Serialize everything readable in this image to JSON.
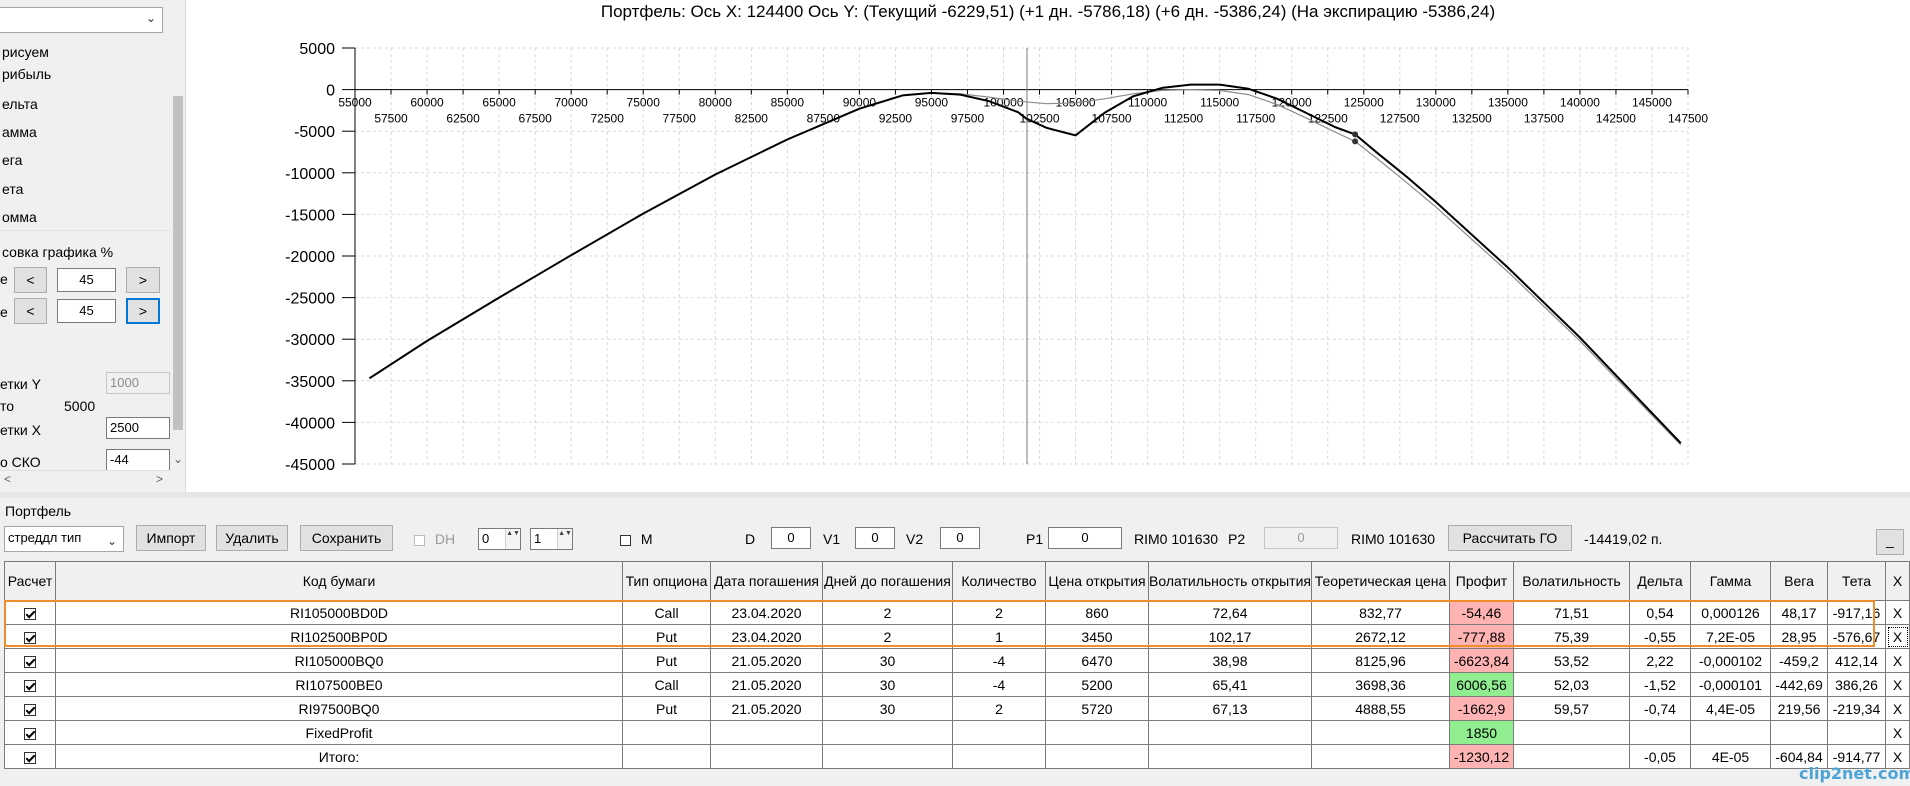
{
  "left_panel": {
    "top_select_value": "",
    "labels": [
      "рисуем",
      "рибыль",
      "ельта",
      "амма",
      "ега",
      "ета",
      "омма"
    ],
    "group_title": "совка графика %",
    "row1_prefix": "е",
    "row2_prefix": "е",
    "dec_label": "<",
    "inc_label": ">",
    "row1_value": "45",
    "row2_value": "45",
    "grid_y_label": "етки Y",
    "grid_y_value": "1000",
    "to_label": "то",
    "to_value": "5000",
    "grid_x_label": "етки X",
    "grid_x_value": "2500",
    "sko_label": "о СКО",
    "sko_value": "-44",
    "scroll_left": "<",
    "scroll_right": ">",
    "chevron": "⌄"
  },
  "chart_title": "Портфель: Ось X: 124400 Ось Y:  (Текущий -6229,51)  (+1 дн. -5786,18)  (+6 дн. -5386,24)  (На экспирацию -5386,24)",
  "chart_data": {
    "type": "line",
    "title": "Портфель: Ось X: 124400 Ось Y:  (Текущий -6229,51)  (+1 дн. -5786,18)  (+6 дн. -5386,24)  (На экспирацию -5386,24)",
    "xlim": [
      55000,
      147500
    ],
    "ylim": [
      -45000,
      5000
    ],
    "x_ticks_upper": [
      55000,
      60000,
      65000,
      70000,
      75000,
      80000,
      85000,
      90000,
      95000,
      100000,
      105000,
      110000,
      115000,
      120000,
      125000,
      130000,
      135000,
      140000,
      145000
    ],
    "x_ticks_lower": [
      57500,
      62500,
      67500,
      72500,
      77500,
      82500,
      87500,
      92500,
      97500,
      102500,
      107500,
      112500,
      117500,
      122500,
      127500,
      132500,
      137500,
      142500,
      147500
    ],
    "y_ticks": [
      5000,
      0,
      -5000,
      -10000,
      -15000,
      -20000,
      -25000,
      -30000,
      -35000,
      -40000,
      -45000
    ],
    "grid": true,
    "vertical_marker_x": 101630,
    "points_x": 124400,
    "series": [
      {
        "color": "#000000",
        "width": 2,
        "x": [
          56000,
          60000,
          65000,
          70000,
          75000,
          80000,
          85000,
          90000,
          93000,
          95000,
          97000,
          99000,
          101000,
          101600,
          103000,
          105000,
          107000,
          109000,
          111000,
          113000,
          115000,
          117000,
          119000,
          121000,
          123000,
          124400,
          126000,
          128000,
          130000,
          135000,
          140000,
          147000
        ],
        "y": [
          -34700,
          -30200,
          -25000,
          -19900,
          -14900,
          -10200,
          -6000,
          -2300,
          -700,
          -400,
          -600,
          -1400,
          -2700,
          -3500,
          -4600,
          -5500,
          -2800,
          -800,
          200,
          600,
          600,
          100,
          -1100,
          -2800,
          -4500,
          -5386,
          -7700,
          -10500,
          -13500,
          -21400,
          -29800,
          -42500
        ]
      },
      {
        "color": "#8c8c8c",
        "width": 1.2,
        "x": [
          56000,
          60000,
          65000,
          70000,
          75000,
          80000,
          85000,
          90000,
          93000,
          95000,
          97000,
          99000,
          101000,
          103000,
          105000,
          107000,
          109000,
          111000,
          113000,
          115000,
          117000,
          119000,
          121000,
          123000,
          124400,
          126000,
          128000,
          130000,
          135000,
          140000,
          147000
        ],
        "y": [
          -34700,
          -30200,
          -25000,
          -19900,
          -14900,
          -10200,
          -6000,
          -2300,
          -700,
          -400,
          -500,
          -900,
          -1400,
          -1700,
          -1600,
          -1100,
          -500,
          -100,
          0,
          -100,
          -600,
          -1800,
          -3400,
          -5100,
          -6230,
          -8400,
          -11200,
          -14100,
          -21900,
          -30200,
          -42700
        ]
      }
    ],
    "markers": [
      {
        "x": 124400,
        "y": -5386
      },
      {
        "x": 124400,
        "y": -6230
      }
    ]
  },
  "portfolio": {
    "section_title": "Портфель",
    "strategy_select": "стреддл тип",
    "import_label": "Импорт",
    "delete_label": "Удалить",
    "save_label": "Сохранить",
    "dh_label": "DH",
    "spin1_value": "0",
    "spin2_value": "1",
    "m_label": "M",
    "d_label": "D",
    "d_value": "0",
    "v1_label": "V1",
    "v1_value": "0",
    "v2_label": "V2",
    "v2_value": "0",
    "p1_label": "P1",
    "p1_value": "0",
    "rim1_label": "RIM0 101630",
    "p2_label": "P2",
    "p2_value": "0",
    "rim2_label": "RIM0 101630",
    "calc_go_label": "Рассчитать ГО",
    "go_value": "-14419,02 п.",
    "minimize_label": "_",
    "spin_arrows": "▲▼"
  },
  "table": {
    "headers": [
      "Расчет",
      "Код бумаги",
      "Тип опциона",
      "Дата погашения",
      "Дней до погашения",
      "Количество",
      "Цена открытия",
      "Волатильность открытия",
      "Теоретическая цена",
      "Профит",
      "Волатильность",
      "Дельта",
      "Гамма",
      "Вега",
      "Тета",
      "X"
    ],
    "rows": [
      {
        "code": "RI105000BD0D",
        "type": "Call",
        "date": "23.04.2020",
        "days": "2",
        "qty": "2",
        "open": "860",
        "vol_open": "72,64",
        "theo": "832,77",
        "profit": "-54,46",
        "profit_color": "red",
        "vol": "71,51",
        "delta": "0,54",
        "gamma": "0,000126",
        "vega": "48,17",
        "theta": "-917,16",
        "del": "X"
      },
      {
        "code": "RI102500BP0D",
        "type": "Put",
        "date": "23.04.2020",
        "days": "2",
        "qty": "1",
        "open": "3450",
        "vol_open": "102,17",
        "theo": "2672,12",
        "profit": "-777,88",
        "profit_color": "red",
        "vol": "75,39",
        "delta": "-0,55",
        "gamma": "7,2E-05",
        "vega": "28,95",
        "theta": "-576,67",
        "del": "X"
      },
      {
        "code": "RI105000BQ0",
        "type": "Put",
        "date": "21.05.2020",
        "days": "30",
        "qty": "-4",
        "open": "6470",
        "vol_open": "38,98",
        "theo": "8125,96",
        "profit": "-6623,84",
        "profit_color": "red",
        "vol": "53,52",
        "delta": "2,22",
        "gamma": "-0,000102",
        "vega": "-459,2",
        "theta": "412,14",
        "del": "X"
      },
      {
        "code": "RI107500BE0",
        "type": "Call",
        "date": "21.05.2020",
        "days": "30",
        "qty": "-4",
        "open": "5200",
        "vol_open": "65,41",
        "theo": "3698,36",
        "profit": "6006,56",
        "profit_color": "green",
        "vol": "52,03",
        "delta": "-1,52",
        "gamma": "-0,000101",
        "vega": "-442,69",
        "theta": "386,26",
        "del": "X"
      },
      {
        "code": "RI97500BQ0",
        "type": "Put",
        "date": "21.05.2020",
        "days": "30",
        "qty": "2",
        "open": "5720",
        "vol_open": "67,13",
        "theo": "4888,55",
        "profit": "-1662,9",
        "profit_color": "red",
        "vol": "59,57",
        "delta": "-0,74",
        "gamma": "4,4E-05",
        "vega": "219,56",
        "theta": "-219,34",
        "del": "X"
      },
      {
        "code": "FixedProfit",
        "type": "",
        "date": "",
        "days": "",
        "qty": "",
        "open": "",
        "vol_open": "",
        "theo": "",
        "profit": "1850",
        "profit_color": "green",
        "vol": "",
        "delta": "",
        "gamma": "",
        "vega": "",
        "theta": "",
        "del": "X"
      },
      {
        "code": "Итого:",
        "type": "",
        "date": "",
        "days": "",
        "qty": "",
        "open": "",
        "vol_open": "",
        "theo": "",
        "profit": "-1230,12",
        "profit_color": "red",
        "vol": "",
        "delta": "-0,05",
        "gamma": "4E-05",
        "vega": "-604,84",
        "theta": "-914,77",
        "del": "X"
      }
    ]
  },
  "watermark": "clip2net.com"
}
